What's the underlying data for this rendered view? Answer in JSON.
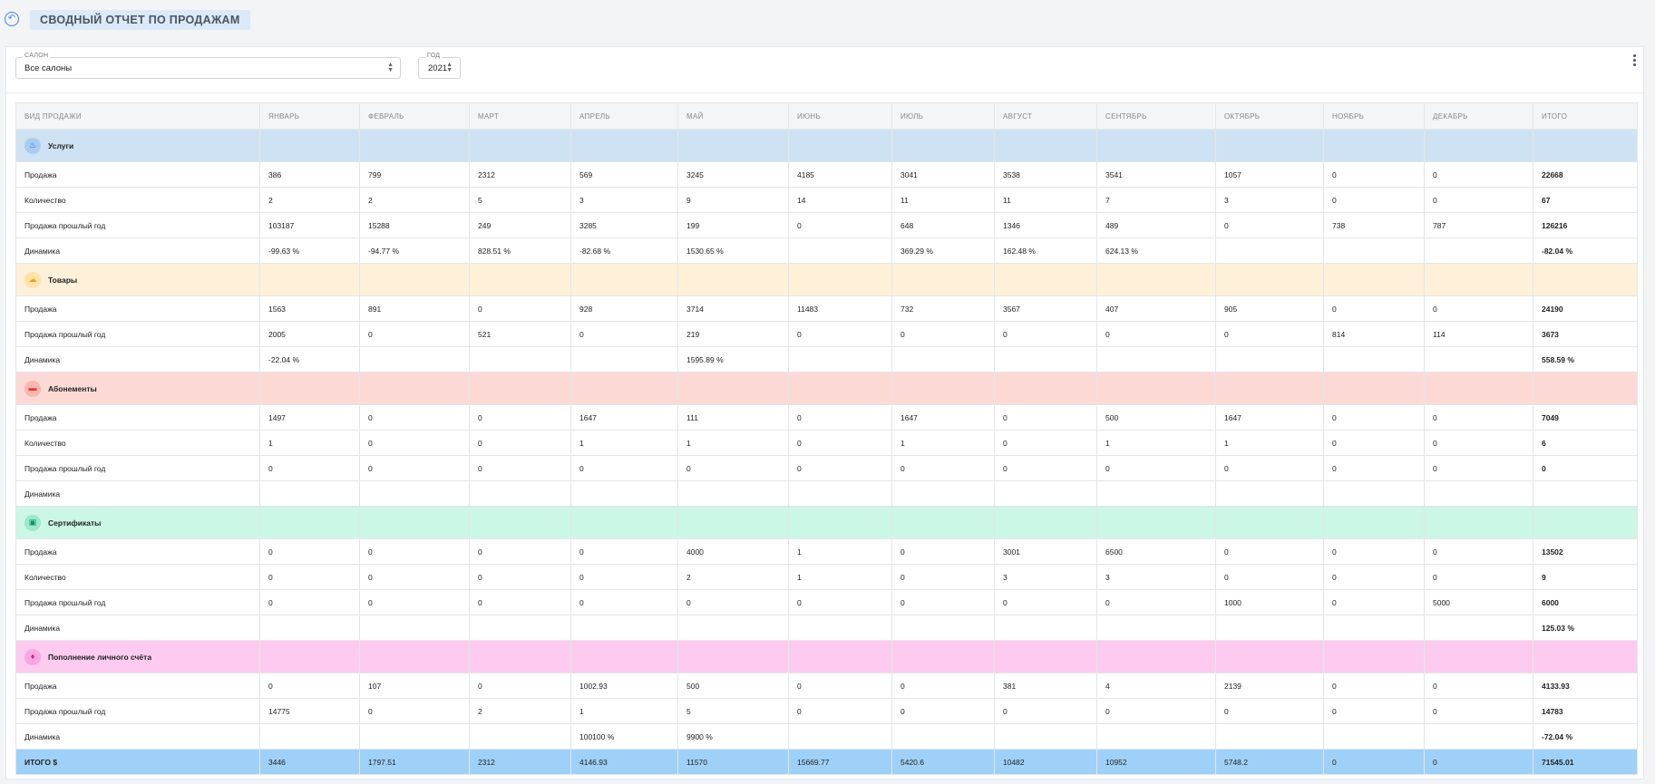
{
  "header": {
    "title": "СВОДНЫЙ ОТЧЕТ ПО ПРОДАЖАМ",
    "back_icon": "back-arrow-icon"
  },
  "filters": {
    "salon": {
      "label": "САЛОН",
      "value": "Все салоны"
    },
    "year": {
      "label": "ГОД",
      "value": "2021"
    }
  },
  "colors": {
    "positive": "#16a34a",
    "negative": "#dc2626",
    "total_row": "#9fd0f8"
  },
  "table": {
    "columns": [
      "ВИД ПРОДАЖИ",
      "ЯНВАРЬ",
      "ФЕВРАЛЬ",
      "МАРТ",
      "АПРЕЛЬ",
      "МАЙ",
      "ИЮНЬ",
      "ИЮЛЬ",
      "АВГУСТ",
      "СЕНТЯБРЬ",
      "ОКТЯБРЬ",
      "НОЯБРЬ",
      "ДЕКАБРЬ",
      "ИТОГО"
    ],
    "groups": [
      {
        "name": "Услуги",
        "icon": "flame-icon",
        "key": "services",
        "rows": [
          {
            "label": "Продажа",
            "cells": [
              "386",
              "799",
              "2312",
              "569",
              "3245",
              "4185",
              "3041",
              "3538",
              "3541",
              "1057",
              "0",
              "0",
              "22668"
            ]
          },
          {
            "label": "Количество",
            "cells": [
              "2",
              "2",
              "5",
              "3",
              "9",
              "14",
              "11",
              "11",
              "7",
              "3",
              "0",
              "0",
              "67"
            ]
          },
          {
            "label": "Продажа прошлый год",
            "cells": [
              "103187",
              "15288",
              "249",
              "3285",
              "199",
              "0",
              "648",
              "1346",
              "489",
              "0",
              "738",
              "787",
              "126216"
            ]
          },
          {
            "label": "Динамика",
            "cells": [
              "-99.63 %",
              "-94.77 %",
              "828.51 %",
              "-82.68 %",
              "1530.65 %",
              "",
              "369.29 %",
              "162.48 %",
              "624.13 %",
              "",
              "",
              "",
              "-82.04 %"
            ]
          }
        ]
      },
      {
        "name": "Товары",
        "icon": "cloud-icon",
        "key": "goods",
        "rows": [
          {
            "label": "Продажа",
            "cells": [
              "1563",
              "891",
              "0",
              "928",
              "3714",
              "11483",
              "732",
              "3567",
              "407",
              "905",
              "0",
              "0",
              "24190"
            ]
          },
          {
            "label": "Продажа прошлый год",
            "cells": [
              "2005",
              "0",
              "521",
              "0",
              "219",
              "0",
              "0",
              "0",
              "0",
              "0",
              "814",
              "114",
              "3673"
            ]
          },
          {
            "label": "Динамика",
            "cells": [
              "-22.04 %",
              "",
              "",
              "",
              "1595.89 %",
              "",
              "",
              "",
              "",
              "",
              "",
              "",
              "558.59 %"
            ]
          }
        ]
      },
      {
        "name": "Абонементы",
        "icon": "ticket-icon",
        "key": "subs",
        "rows": [
          {
            "label": "Продажа",
            "cells": [
              "1497",
              "0",
              "0",
              "1647",
              "111",
              "0",
              "1647",
              "0",
              "500",
              "1647",
              "0",
              "0",
              "7049"
            ]
          },
          {
            "label": "Количество",
            "cells": [
              "1",
              "0",
              "0",
              "1",
              "1",
              "0",
              "1",
              "0",
              "1",
              "1",
              "0",
              "0",
              "6"
            ]
          },
          {
            "label": "Продажа прошлый год",
            "cells": [
              "0",
              "0",
              "0",
              "0",
              "0",
              "0",
              "0",
              "0",
              "0",
              "0",
              "0",
              "0",
              "0"
            ]
          },
          {
            "label": "Динамика",
            "cells": [
              "",
              "",
              "",
              "",
              "",
              "",
              "",
              "",
              "",
              "",
              "",
              "",
              ""
            ]
          }
        ]
      },
      {
        "name": "Сертификаты",
        "icon": "gift-icon",
        "key": "certs",
        "rows": [
          {
            "label": "Продажа",
            "cells": [
              "0",
              "0",
              "0",
              "0",
              "4000",
              "1",
              "0",
              "3001",
              "6500",
              "0",
              "0",
              "0",
              "13502"
            ]
          },
          {
            "label": "Количество",
            "cells": [
              "0",
              "0",
              "0",
              "0",
              "2",
              "1",
              "0",
              "3",
              "3",
              "0",
              "0",
              "0",
              "9"
            ]
          },
          {
            "label": "Продажа прошлый год",
            "cells": [
              "0",
              "0",
              "0",
              "0",
              "0",
              "0",
              "0",
              "0",
              "0",
              "1000",
              "0",
              "5000",
              "6000"
            ]
          },
          {
            "label": "Динамика",
            "cells": [
              "",
              "",
              "",
              "",
              "",
              "",
              "",
              "",
              "",
              "",
              "",
              "",
              "125.03 %"
            ]
          }
        ]
      },
      {
        "name": "Пополнение личного счёта",
        "icon": "wallet-icon",
        "key": "topup",
        "rows": [
          {
            "label": "Продажа",
            "cells": [
              "0",
              "107",
              "0",
              "1002.93",
              "500",
              "0",
              "0",
              "381",
              "4",
              "2139",
              "0",
              "0",
              "4133.93"
            ]
          },
          {
            "label": "Продажа прошлый год",
            "cells": [
              "14775",
              "0",
              "2",
              "1",
              "5",
              "0",
              "0",
              "0",
              "0",
              "0",
              "0",
              "0",
              "14783"
            ]
          },
          {
            "label": "Динамика",
            "cells": [
              "",
              "",
              "",
              "100100 %",
              "9900 %",
              "",
              "",
              "",
              "",
              "",
              "",
              "",
              "-72.04 %"
            ]
          }
        ]
      }
    ],
    "total": {
      "label": "ИТОГО $",
      "cells": [
        "3446",
        "1797.51",
        "2312",
        "4146.93",
        "11570",
        "15669.77",
        "5420.6",
        "10482",
        "10952",
        "5748.2",
        "0",
        "0",
        "71545.01"
      ]
    }
  }
}
